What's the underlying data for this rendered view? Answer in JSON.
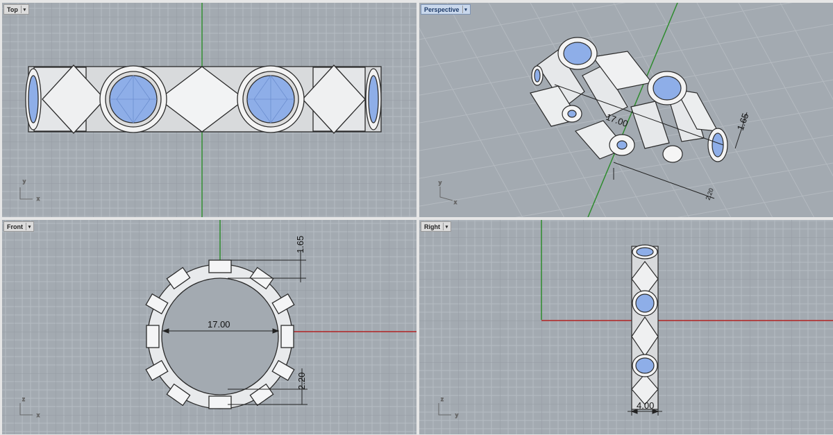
{
  "viewports": {
    "top": {
      "label": "Top"
    },
    "perspective": {
      "label": "Perspective"
    },
    "front": {
      "label": "Front"
    },
    "right": {
      "label": "Right"
    }
  },
  "dimensions": {
    "perspective_diameter": "17.00",
    "perspective_thickness": "1.65",
    "perspective_width": "2.20",
    "front_thickness": "1.65",
    "front_diameter": "17.00",
    "front_bottom": "2.20",
    "right_width": "4.00"
  },
  "axes": {
    "x": "x",
    "y": "y",
    "z": "z"
  },
  "colors": {
    "viewport_bg": "#a3aab1",
    "grid_minor": "#b5bbc1",
    "grid_major": "#939aa1",
    "axis_green": "#2e8b2e",
    "axis_red": "#b22222",
    "metal": "#e2e4e6",
    "gem": "#8eaee8"
  },
  "icons": {
    "dropdown": "chevron-down-icon",
    "axis_widget": "axis-widget-icon"
  }
}
